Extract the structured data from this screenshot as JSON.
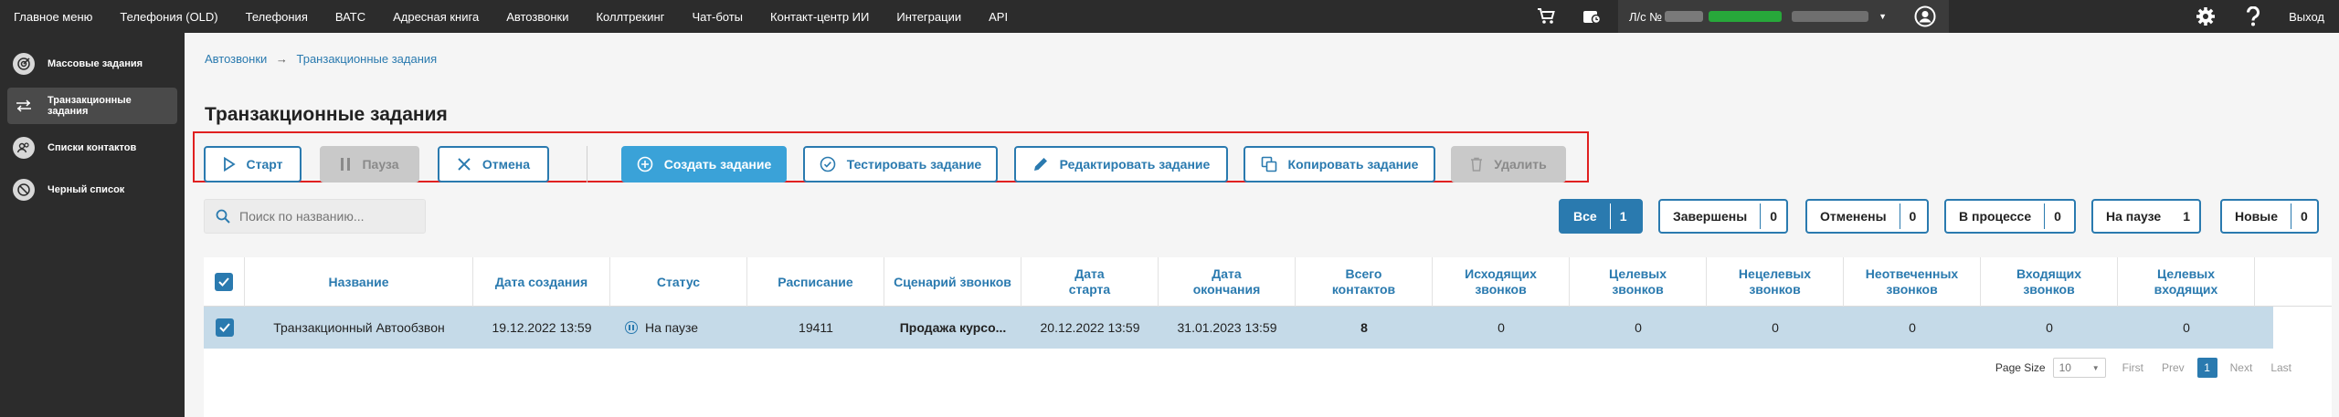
{
  "topnav": {
    "menu": [
      "Главное меню",
      "Телефония (OLD)",
      "Телефония",
      "ВАТС",
      "Адресная книга",
      "Автозвонки",
      "Коллтрекинг",
      "Чат-боты",
      "Контакт-центр ИИ",
      "Интеграции",
      "API"
    ],
    "account_prefix": "Л/с №",
    "logout": "Выход"
  },
  "sidebar": {
    "items": [
      {
        "label": "Массовые задания",
        "icon": "target-icon"
      },
      {
        "label": "Транзакционные задания",
        "icon": "transfer-icon"
      },
      {
        "label": "Списки контактов",
        "icon": "contacts-icon"
      },
      {
        "label": "Черный список",
        "icon": "block-icon"
      }
    ]
  },
  "breadcrumb": {
    "parent": "Автозвонки",
    "current": "Транзакционные задания"
  },
  "page_title": "Транзакционные задания",
  "toolbar": {
    "start": "Старт",
    "pause": "Пауза",
    "cancel": "Отмена",
    "create": "Создать задание",
    "test": "Тестировать задание",
    "edit": "Редактировать задание",
    "copy": "Копировать задание",
    "delete": "Удалить"
  },
  "search": {
    "placeholder": "Поиск по названию..."
  },
  "filters": [
    {
      "label": "Все",
      "count": "1"
    },
    {
      "label": "Завершены",
      "count": "0"
    },
    {
      "label": "Отменены",
      "count": "0"
    },
    {
      "label": "В процессе",
      "count": "0"
    },
    {
      "label": "На паузе",
      "count": "1"
    },
    {
      "label": "Новые",
      "count": "0"
    }
  ],
  "table": {
    "headers": [
      "Название",
      "Дата создания",
      "Статус",
      "Расписание",
      "Сценарий звонков",
      "Дата старта",
      "Дата окончания",
      "Всего контактов",
      "Исходящих звонков",
      "Целевых звонков",
      "Нецелевых звонков",
      "Неотвеченных звонков",
      "Входящих звонков",
      "Целевых входящих"
    ],
    "rows": [
      {
        "name": "Транзакционный Автообзвон",
        "created": "19.12.2022 13:59",
        "status": "На паузе",
        "schedule": "19411",
        "scenario": "Продажа курсо...",
        "start": "20.12.2022 13:59",
        "end": "31.01.2023 13:59",
        "total": "8",
        "outgoing": "0",
        "target": "0",
        "nontarget": "0",
        "unanswered": "0",
        "incoming": "0",
        "target_incoming": "0"
      }
    ]
  },
  "pager": {
    "page_size_label": "Page Size",
    "page_size": "10",
    "first": "First",
    "prev": "Prev",
    "current": "1",
    "next": "Next",
    "last": "Last"
  }
}
